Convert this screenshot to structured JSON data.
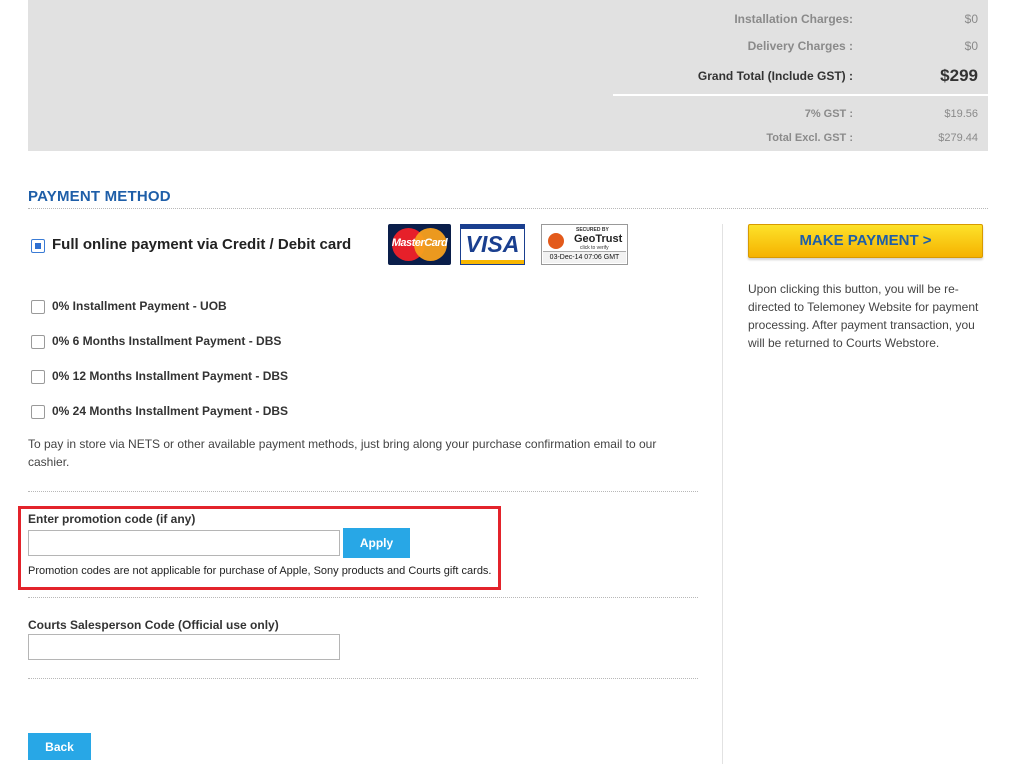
{
  "summary": {
    "installation_label": "Installation Charges:",
    "installation_value": "$0",
    "delivery_label": "Delivery Charges :",
    "delivery_value": "$0",
    "grand_total_label": "Grand Total (Include GST) :",
    "grand_total_value": "$299",
    "gst_label": "7% GST :",
    "gst_value": "$19.56",
    "excl_label": "Total Excl. GST :",
    "excl_value": "$279.44"
  },
  "payment": {
    "title": "PAYMENT METHOD",
    "options": [
      {
        "label": "Full online payment via Credit / Debit card",
        "checked": true
      },
      {
        "label": "0% Installment Payment - UOB",
        "checked": false
      },
      {
        "label": "0% 6 Months Installment Payment - DBS",
        "checked": false
      },
      {
        "label": "0% 12 Months Installment Payment - DBS",
        "checked": false
      },
      {
        "label": "0% 24 Months Installment Payment - DBS",
        "checked": false
      }
    ],
    "logos": {
      "mastercard": "MasterCard",
      "visa": "VISA",
      "geotrust_secured": "SECURED BY",
      "geotrust_name": "GeoTrust",
      "geotrust_click": "click to verify",
      "geotrust_date": "03-Dec-14 07:06 GMT"
    },
    "store_note": "To pay in store via NETS or other available payment methods, just bring along your purchase confirmation email to our cashier."
  },
  "promo": {
    "label": "Enter promotion code (if any)",
    "value": "",
    "apply_label": "Apply",
    "note": "Promotion codes are not applicable for purchase of Apple, Sony products and Courts gift cards."
  },
  "salesperson": {
    "label": "Courts Salesperson Code (Official use only)",
    "value": ""
  },
  "back_label": "Back",
  "make_payment": {
    "label": "MAKE PAYMENT >",
    "note": "Upon clicking this button, you will be re-directed to Telemoney Website for payment processing. After payment transaction, you will be returned to Courts Webstore."
  },
  "colors": {
    "accent_blue": "#1e5ea8",
    "button_blue": "#28a7e6",
    "highlight_red": "#e3232b",
    "pay_yellow": "#f5b200"
  }
}
